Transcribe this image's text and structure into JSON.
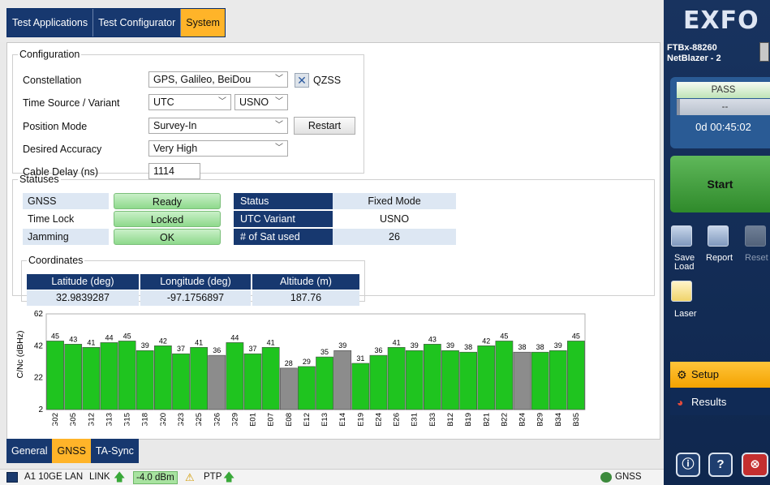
{
  "top_tabs": [
    "Test Applications",
    "Test Configurator",
    "System"
  ],
  "config": {
    "legend": "Configuration",
    "constellation_label": "Constellation",
    "constellation_value": "GPS, Galileo, BeiDou",
    "qzss_label": "QZSS",
    "time_source_label": "Time Source / Variant",
    "time_source_value": "UTC",
    "variant_value": "USNO",
    "position_mode_label": "Position Mode",
    "position_mode_value": "Survey-In",
    "restart_label": "Restart",
    "accuracy_label": "Desired Accuracy",
    "accuracy_value": "Very High",
    "cable_delay_label": "Cable Delay (ns)",
    "cable_delay_value": "1114"
  },
  "statuses": {
    "legend": "Statuses",
    "gnss_label": "GNSS",
    "gnss_value": "Ready",
    "timelock_label": "Time Lock",
    "timelock_value": "Locked",
    "jamming_label": "Jamming",
    "jamming_value": "OK",
    "status_label": "Status",
    "status_value": "Fixed Mode",
    "utc_variant_label": "UTC Variant",
    "utc_variant_value": "USNO",
    "sat_used_label": "# of Sat used",
    "sat_used_value": "26"
  },
  "coordinates": {
    "legend": "Coordinates",
    "lat_label": "Latitude (deg)",
    "lat_value": "32.9839287",
    "lon_label": "Longitude (deg)",
    "lon_value": "-97.1756897",
    "alt_label": "Altitude (m)",
    "alt_value": "187.76"
  },
  "chart_data": {
    "type": "bar",
    "ylabel": "C/Nc (dBHz)",
    "yticks": [
      2,
      22,
      42,
      62
    ],
    "ylim": [
      2,
      62
    ],
    "categories": [
      "G02",
      "G05",
      "G12",
      "G13",
      "G15",
      "G18",
      "G20",
      "G23",
      "G25",
      "G26",
      "G29",
      "E01",
      "E07",
      "E08",
      "E12",
      "E13",
      "E14",
      "E19",
      "E24",
      "E26",
      "E31",
      "E33",
      "B12",
      "B19",
      "B21",
      "B22",
      "B24",
      "B29",
      "B34",
      "B35"
    ],
    "values": [
      45,
      43,
      41,
      44,
      45,
      39,
      42,
      37,
      41,
      36,
      44,
      37,
      41,
      28,
      29,
      35,
      39,
      31,
      36,
      41,
      39,
      43,
      39,
      38,
      42,
      45,
      38,
      38,
      39,
      45
    ],
    "used": [
      true,
      true,
      true,
      true,
      true,
      true,
      true,
      true,
      true,
      false,
      true,
      true,
      true,
      false,
      true,
      true,
      false,
      true,
      true,
      true,
      true,
      true,
      true,
      true,
      true,
      true,
      false,
      true,
      true,
      true
    ],
    "colors": {
      "used": "#1fc41f",
      "unused": "#8c8c8c"
    }
  },
  "bottom_tabs": [
    "General",
    "GNSS",
    "TA-Sync"
  ],
  "statusbar": {
    "port": "A1 10GE LAN",
    "link": "LINK",
    "power": "-4.0 dBm",
    "ptp": "PTP",
    "gnss": "GNSS"
  },
  "right_panel": {
    "logo": "EXFO",
    "model_line1": "FTBx-88260",
    "model_line2": "NetBlazer - 2",
    "pass": "PASS",
    "dash": "--",
    "timer": "0d 00:45:02",
    "start": "Start",
    "save_load_1": "Save",
    "save_load_2": "Load",
    "report": "Report",
    "reset": "Reset",
    "laser": "Laser",
    "setup": "Setup",
    "results": "Results"
  }
}
